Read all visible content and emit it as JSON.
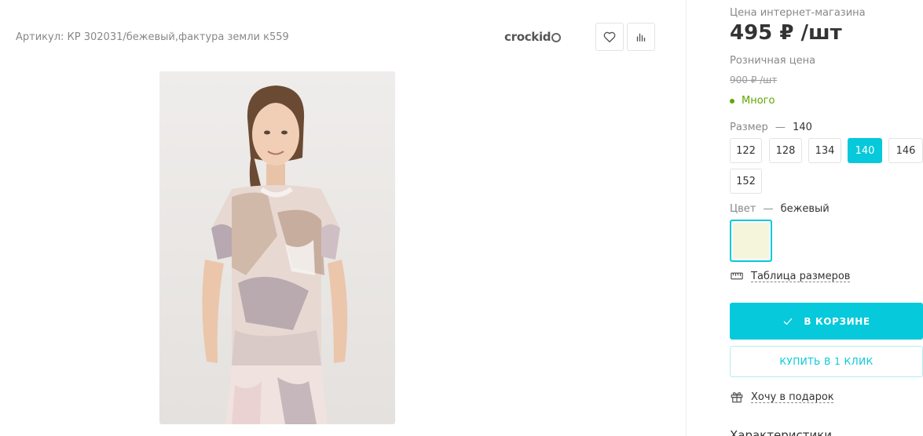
{
  "product": {
    "article": "Артикул: КР 302031/бежевый,фактура земли к559",
    "brand": "crockid"
  },
  "pricing": {
    "online_label": "Цена интернет-магазина",
    "price": "495 ₽ /шт",
    "retail_label": "Розничная цена",
    "old_price": "900 ₽ /шт",
    "stock": "Много"
  },
  "size": {
    "label": "Размер",
    "dash": "—",
    "selected": "140",
    "options": [
      "122",
      "128",
      "134",
      "140",
      "146",
      "152"
    ]
  },
  "color": {
    "label": "Цвет",
    "dash": "—",
    "selected": "бежевый",
    "swatch_hex": "#f5f5dc"
  },
  "links": {
    "size_table": "Таблица размеров",
    "gift": "Хочу в подарок"
  },
  "buttons": {
    "in_cart": "В КОРЗИНЕ",
    "one_click": "КУПИТЬ В 1 КЛИК"
  },
  "sections": {
    "characteristics": "Характеристики"
  },
  "icons": {
    "favorite": "heart-icon",
    "compare": "bar-chart-icon",
    "ruler": "ruler-icon",
    "gift": "gift-icon",
    "check": "check-icon"
  },
  "colors": {
    "accent": "#06c9db",
    "stock": "#5fa700"
  }
}
